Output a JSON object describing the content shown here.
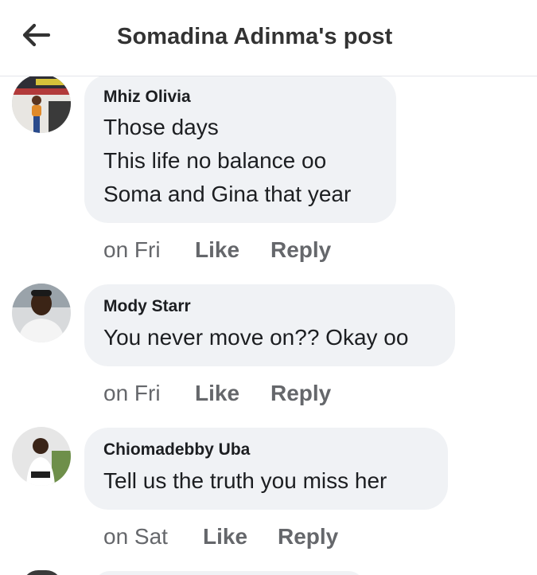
{
  "header": {
    "title": "Somadina Adinma's post",
    "back_icon": "arrow-left-icon"
  },
  "colors": {
    "bubble": "#f0f2f5",
    "text": "#1c1e21",
    "meta": "#65676b",
    "header_text": "#333333"
  },
  "comments": [
    {
      "author": "Mhiz Olivia",
      "lines": [
        "Those days",
        "This life no balance oo",
        "Soma and Gina that year"
      ],
      "time": "on Fri",
      "like_label": "Like",
      "reply_label": "Reply"
    },
    {
      "author": "Mody Starr",
      "lines": [
        "You never move on?? Okay oo"
      ],
      "time": "on Fri",
      "like_label": "Like",
      "reply_label": "Reply"
    },
    {
      "author": "Chiomadebby Uba",
      "lines": [
        "Tell us the truth you miss her"
      ],
      "time": "on Sat",
      "like_label": "Like",
      "reply_label": "Reply"
    }
  ]
}
